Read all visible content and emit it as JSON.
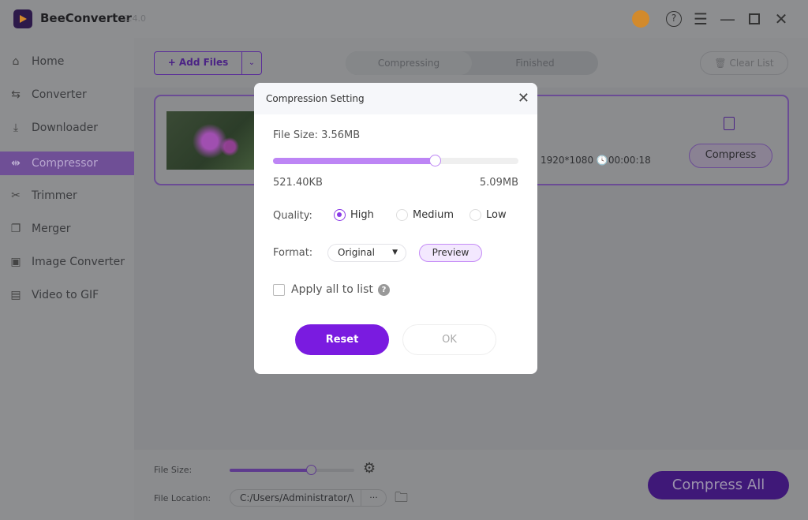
{
  "app": {
    "name": "BeeConverter",
    "version": "1.4.0"
  },
  "titlebar": {
    "icons": [
      "user-avatar-icon",
      "help-icon",
      "menu-icon",
      "minimize-icon",
      "maximize-icon",
      "close-icon"
    ],
    "avatar_color": "#d28a2c"
  },
  "sidebar": {
    "items": [
      {
        "label": "Home",
        "icon": "home-icon"
      },
      {
        "label": "Converter",
        "icon": "convert-arrows-icon"
      },
      {
        "label": "Downloader",
        "icon": "download-icon"
      },
      {
        "label": "Compressor",
        "icon": "compress-icon",
        "active": true
      },
      {
        "label": "Trimmer",
        "icon": "scissors-icon"
      },
      {
        "label": "Merger",
        "icon": "merge-icon"
      },
      {
        "label": "Image Converter",
        "icon": "image-icon"
      },
      {
        "label": "Video to GIF",
        "icon": "gif-icon"
      }
    ]
  },
  "toolbar": {
    "add_files": "+ Add Files",
    "tabs": [
      "Compressing",
      "Finished"
    ],
    "active_tab": "Compressing",
    "clear_list": "Clear List"
  },
  "file_card": {
    "resolution": "1920*1080",
    "duration": "00:00:18",
    "compress_label": "Compress"
  },
  "bottom": {
    "file_size_label": "File Size:",
    "file_size_level_percent": 65,
    "file_location_label": "File Location:",
    "file_location_value": "C:/Users/Administrator/\\",
    "more_label": "···",
    "compress_all": "Compress All"
  },
  "dialog": {
    "title": "Compression Setting",
    "file_size": "File Size: 3.56MB",
    "slider_percent": 66,
    "min_label": "521.40KB",
    "max_label": "5.09MB",
    "quality_label": "Quality:",
    "quality_options": [
      "High",
      "Medium",
      "Low"
    ],
    "quality_selected": "High",
    "format_label": "Format:",
    "format_value": "Original",
    "preview_label": "Preview",
    "apply_all_label": "Apply all to list",
    "apply_all_checked": false,
    "reset_label": "Reset",
    "ok_label": "OK",
    "accent": "#7a1be0"
  }
}
